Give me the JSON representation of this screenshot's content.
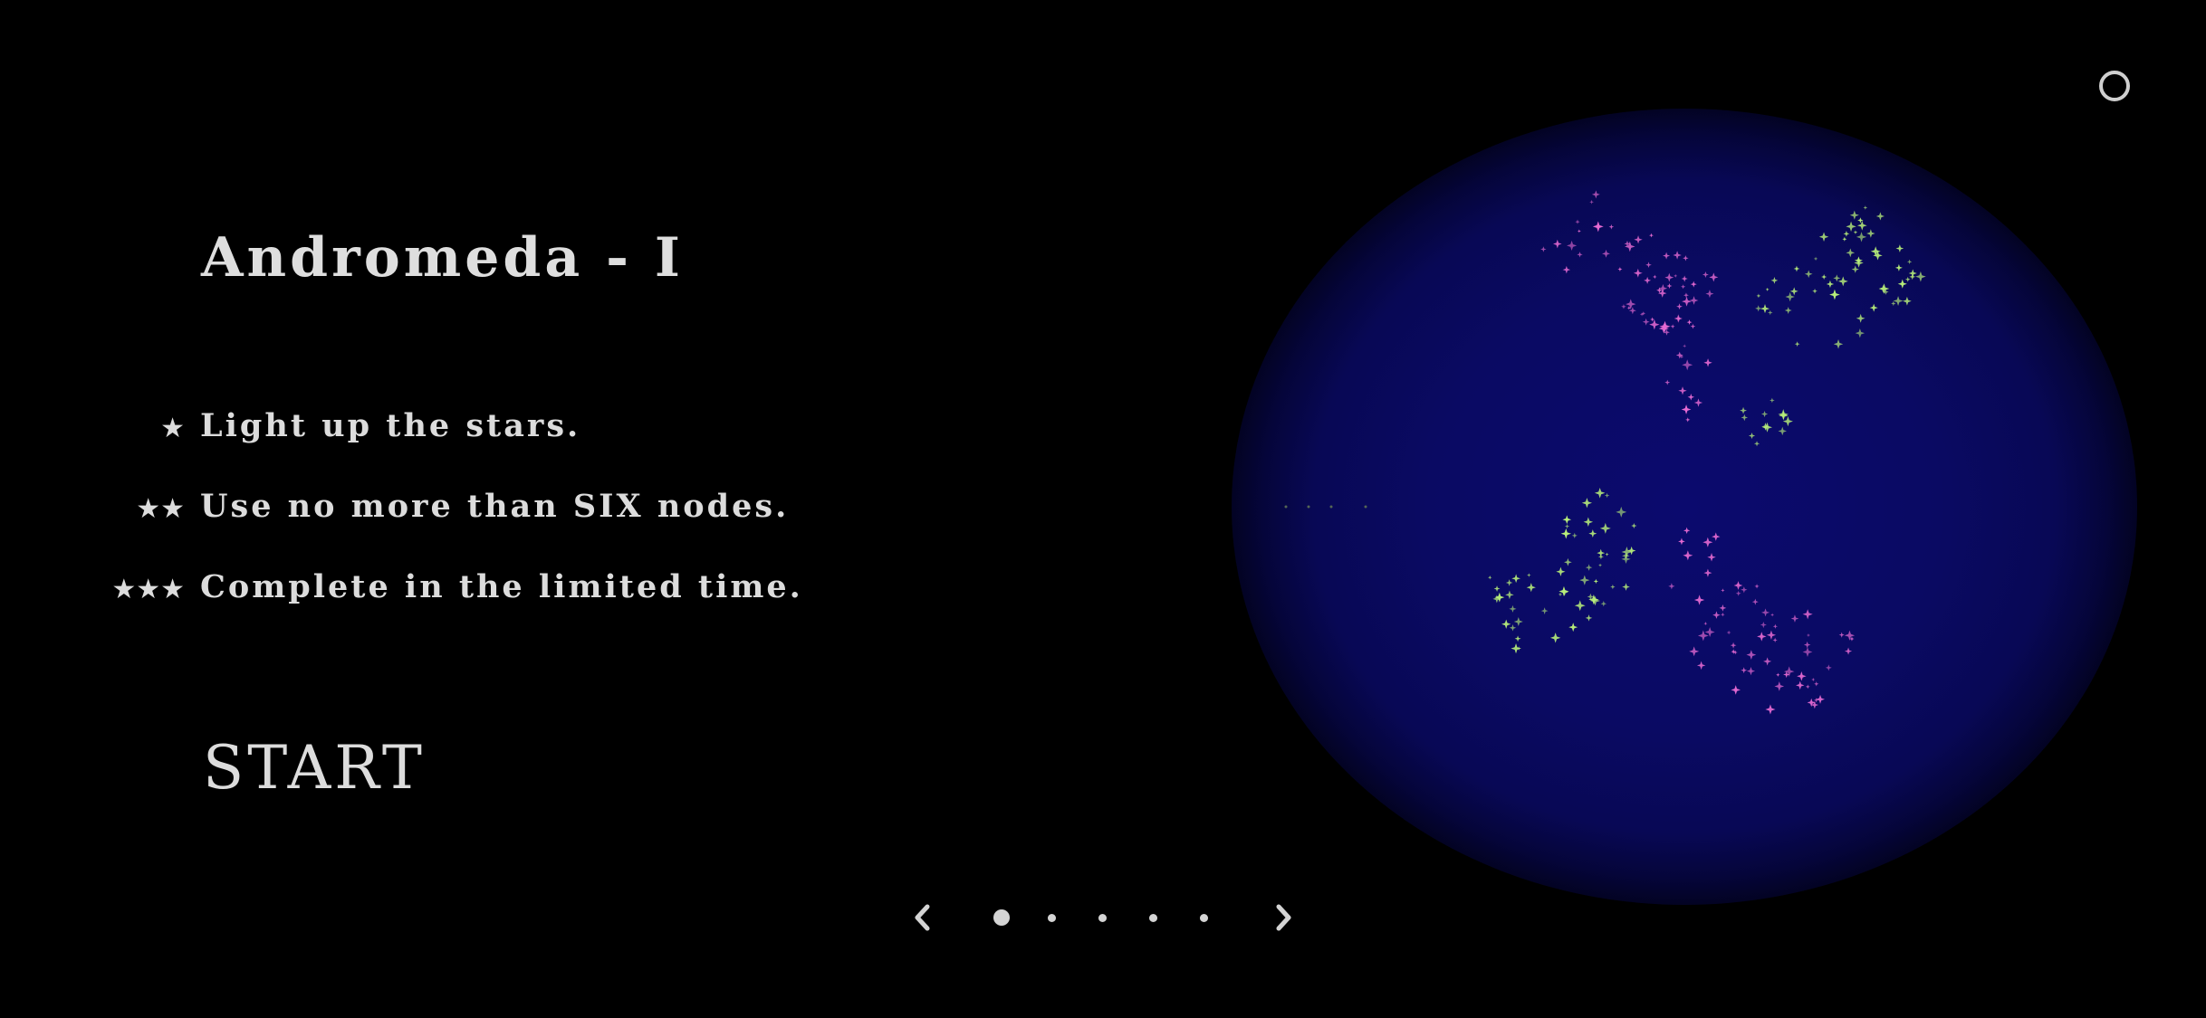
{
  "level": {
    "title": "Andromeda - I"
  },
  "objectives": [
    {
      "stars": "★",
      "text": "Light up the stars."
    },
    {
      "stars": "★★",
      "text": "Use no more than SIX nodes."
    },
    {
      "stars": "★★★",
      "text": "Complete in the limited time."
    }
  ],
  "start_label": "START",
  "menu_icon": "circle-menu-icon",
  "pager": {
    "total_pages": 5,
    "current_page": 1
  },
  "colors": {
    "background": "#000000",
    "galaxy_glow": "#0b0a6e",
    "pink_stars": "#e66ad2",
    "green_stars": "#b9f07a",
    "text": "#dcdcdc"
  }
}
